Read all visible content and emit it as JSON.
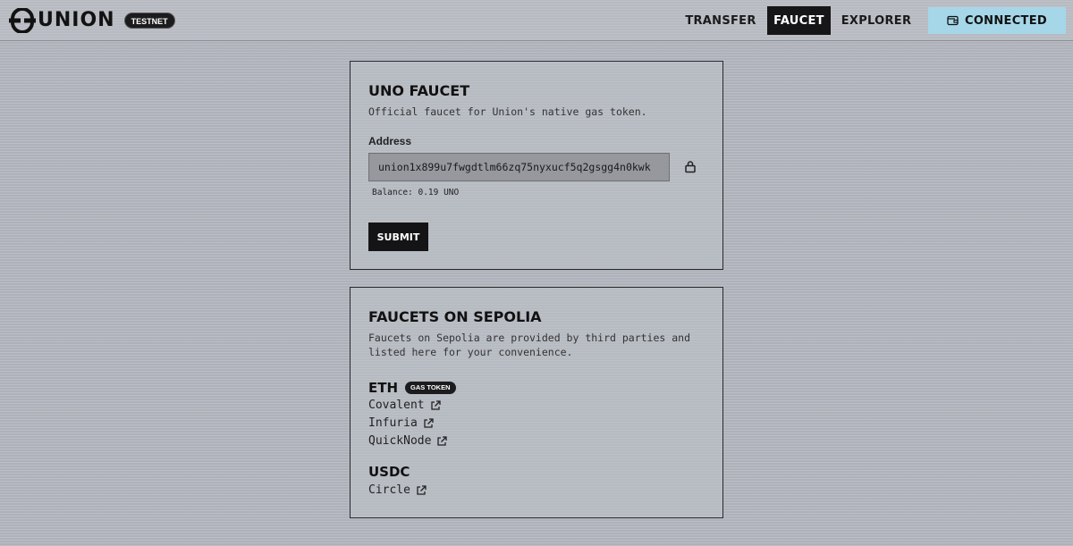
{
  "header": {
    "logo_text": "UNION",
    "env_badge": "TESTNET",
    "nav": [
      {
        "label": "TRANSFER",
        "active": false
      },
      {
        "label": "FAUCET",
        "active": true
      },
      {
        "label": "EXPLORER",
        "active": false
      }
    ],
    "connect_label": "CONNECTED",
    "connect_icon": "wallet-icon",
    "connect_color": "#a6d7e8"
  },
  "uno_faucet": {
    "title": "UNO FAUCET",
    "description": "Official faucet for Union's native gas token.",
    "address_label": "Address",
    "address_value": "union1x899u7fwgdtlm66zq75nyxucf5q2gsgg4n0kwk",
    "lock_icon": "lock-icon",
    "balance_text": "Balance: 0.19 UNO",
    "submit_label": "SUBMIT"
  },
  "sepolia": {
    "title": "FAUCETS ON SEPOLIA",
    "description_line1": "Faucets on Sepolia are provided by third parties and",
    "description_line2": "listed here for your convenience.",
    "tokens": [
      {
        "name": "ETH",
        "badge": "GAS TOKEN",
        "links": [
          "Covalent",
          "Infuria",
          "QuickNode"
        ]
      },
      {
        "name": "USDC",
        "badge": "",
        "links": [
          "Circle"
        ]
      }
    ],
    "link_icon": "external-link-icon"
  }
}
